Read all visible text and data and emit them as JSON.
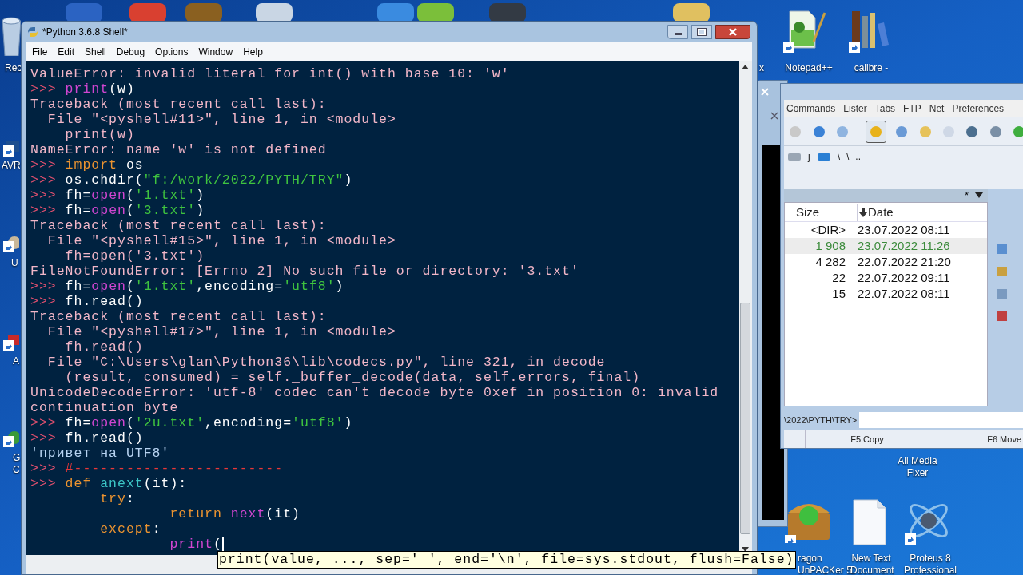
{
  "desktop": {
    "icons": [
      {
        "lines": [
          "Rec"
        ]
      },
      {
        "lines": [
          "AVR"
        ]
      },
      {
        "lines": [
          "U"
        ]
      },
      {
        "lines": [
          "A"
        ]
      },
      {
        "lines": [
          "G",
          "C"
        ]
      },
      {
        "lines": [
          "x"
        ]
      },
      {
        "lines": [
          "Notepad++"
        ]
      },
      {
        "lines": [
          "calibre -"
        ]
      },
      {
        "lines": [
          "All Media",
          "Fixer"
        ]
      },
      {
        "lines": [
          "ragon",
          "UnPACKer 5"
        ]
      },
      {
        "lines": [
          "New Text",
          "Document"
        ]
      },
      {
        "lines": [
          "Proteus 8",
          "Professional"
        ]
      }
    ]
  },
  "file_manager": {
    "menu": [
      "Commands",
      "Lister",
      "Tabs",
      "FTP",
      "Net",
      "Preferences"
    ],
    "path_items": [
      "j",
      "\\",
      "\\",
      ".."
    ],
    "filter": "*",
    "columns": [
      "Size",
      "Date"
    ],
    "rows": [
      {
        "size": "<DIR>",
        "date": "23.07.2022 08:11",
        "selected": false
      },
      {
        "size": "1 908",
        "date": "23.07.2022 11:26",
        "selected": true
      },
      {
        "size": "4 282",
        "date": "22.07.2022 21:20",
        "selected": false
      },
      {
        "size": "22",
        "date": "22.07.2022 09:11",
        "selected": false
      },
      {
        "size": "15",
        "date": "22.07.2022 08:11",
        "selected": false
      }
    ],
    "command_path": "\\2022\\PYTH\\TRY>",
    "buttons": [
      "F5 Copy",
      "F6 Move"
    ]
  },
  "shell": {
    "title": "*Python 3.6.8 Shell*",
    "menu": [
      "File",
      "Edit",
      "Shell",
      "Debug",
      "Options",
      "Window",
      "Help"
    ],
    "lines": [
      [
        {
          "kind": "error",
          "t": "ValueError: invalid literal for int() with base 10: 'w'"
        }
      ],
      [
        {
          "kind": "prompt",
          "t": ">>> "
        },
        {
          "kind": "builtin",
          "t": "print"
        },
        {
          "kind": "normal",
          "t": "(w)"
        }
      ],
      [
        {
          "kind": "error",
          "t": "Traceback (most recent call last):"
        }
      ],
      [
        {
          "kind": "error",
          "t": "  File \"<pyshell#11>\", line 1, in <module>"
        }
      ],
      [
        {
          "kind": "error",
          "t": "    print(w)"
        }
      ],
      [
        {
          "kind": "error",
          "t": "NameError: name 'w' is not defined"
        }
      ],
      [
        {
          "kind": "prompt",
          "t": ">>> "
        },
        {
          "kind": "keyword",
          "t": "import"
        },
        {
          "kind": "normal",
          "t": " os"
        }
      ],
      [
        {
          "kind": "prompt",
          "t": ">>> "
        },
        {
          "kind": "normal",
          "t": "os.chdir("
        },
        {
          "kind": "string",
          "t": "\"f:/work/2022/PYTH/TRY\""
        },
        {
          "kind": "normal",
          "t": ")"
        }
      ],
      [
        {
          "kind": "prompt",
          "t": ">>> "
        },
        {
          "kind": "normal",
          "t": "fh="
        },
        {
          "kind": "builtin",
          "t": "open"
        },
        {
          "kind": "normal",
          "t": "("
        },
        {
          "kind": "string",
          "t": "'1.txt'"
        },
        {
          "kind": "normal",
          "t": ")"
        }
      ],
      [
        {
          "kind": "prompt",
          "t": ">>> "
        },
        {
          "kind": "normal",
          "t": "fh="
        },
        {
          "kind": "builtin",
          "t": "open"
        },
        {
          "kind": "normal",
          "t": "("
        },
        {
          "kind": "string",
          "t": "'3.txt'"
        },
        {
          "kind": "normal",
          "t": ")"
        }
      ],
      [
        {
          "kind": "error",
          "t": "Traceback (most recent call last):"
        }
      ],
      [
        {
          "kind": "error",
          "t": "  File \"<pyshell#15>\", line 1, in <module>"
        }
      ],
      [
        {
          "kind": "error",
          "t": "    fh=open('3.txt')"
        }
      ],
      [
        {
          "kind": "error",
          "t": "FileNotFoundError: [Errno 2] No such file or directory: '3.txt'"
        }
      ],
      [
        {
          "kind": "prompt",
          "t": ">>> "
        },
        {
          "kind": "normal",
          "t": "fh="
        },
        {
          "kind": "builtin",
          "t": "open"
        },
        {
          "kind": "normal",
          "t": "("
        },
        {
          "kind": "string",
          "t": "'1.txt'"
        },
        {
          "kind": "normal",
          "t": ",encoding="
        },
        {
          "kind": "string",
          "t": "'utf8'"
        },
        {
          "kind": "normal",
          "t": ")"
        }
      ],
      [
        {
          "kind": "prompt",
          "t": ">>> "
        },
        {
          "kind": "normal",
          "t": "fh.read()"
        }
      ],
      [
        {
          "kind": "error",
          "t": "Traceback (most recent call last):"
        }
      ],
      [
        {
          "kind": "error",
          "t": "  File \"<pyshell#17>\", line 1, in <module>"
        }
      ],
      [
        {
          "kind": "error",
          "t": "    fh.read()"
        }
      ],
      [
        {
          "kind": "error",
          "t": "  File \"C:\\Users\\glan\\Python36\\lib\\codecs.py\", line 321, in decode"
        }
      ],
      [
        {
          "kind": "error",
          "t": "    (result, consumed) = self._buffer_decode(data, self.errors, final)"
        }
      ],
      [
        {
          "kind": "error",
          "t": "UnicodeDecodeError: 'utf-8' codec can't decode byte 0xef in position 0: invalid"
        }
      ],
      [
        {
          "kind": "error",
          "t": "continuation byte"
        }
      ],
      [
        {
          "kind": "prompt",
          "t": ">>> "
        },
        {
          "kind": "normal",
          "t": "fh="
        },
        {
          "kind": "builtin",
          "t": "open"
        },
        {
          "kind": "normal",
          "t": "("
        },
        {
          "kind": "string",
          "t": "'2u.txt'"
        },
        {
          "kind": "normal",
          "t": ",encoding="
        },
        {
          "kind": "string",
          "t": "'utf8'"
        },
        {
          "kind": "normal",
          "t": ")"
        }
      ],
      [
        {
          "kind": "prompt",
          "t": ">>> "
        },
        {
          "kind": "normal",
          "t": "fh.read()"
        }
      ],
      [
        {
          "kind": "output",
          "t": "'привет на UTF8'"
        }
      ],
      [
        {
          "kind": "prompt",
          "t": ">>> "
        },
        {
          "kind": "comment",
          "t": "#------------------------"
        }
      ],
      [
        {
          "kind": "prompt",
          "t": ">>> "
        },
        {
          "kind": "keyword",
          "t": "def "
        },
        {
          "kind": "defname",
          "t": "anext"
        },
        {
          "kind": "normal",
          "t": "(it):"
        }
      ],
      [
        {
          "kind": "keyword",
          "t": "        try"
        },
        {
          "kind": "normal",
          "t": ":"
        }
      ],
      [
        {
          "kind": "keyword",
          "t": "                return "
        },
        {
          "kind": "builtin",
          "t": "next"
        },
        {
          "kind": "normal",
          "t": "(it)"
        }
      ],
      [
        {
          "kind": "keyword",
          "t": "        except"
        },
        {
          "kind": "normal",
          "t": ":"
        }
      ],
      [
        {
          "kind": "builtin",
          "t": "                print"
        },
        {
          "kind": "normal",
          "t": "("
        }
      ]
    ],
    "calltip": "print(value, ..., sep=' ', end='\\n', file=sys.stdout, flush=False)"
  }
}
